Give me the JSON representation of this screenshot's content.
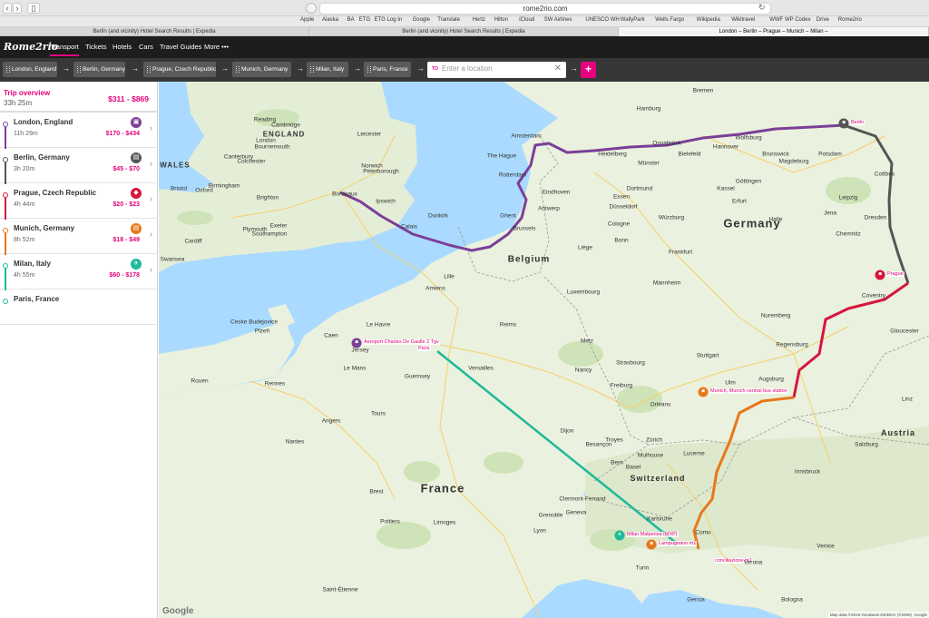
{
  "browser": {
    "url": "rome2rio.com",
    "back_icon": "chevron-left-icon",
    "forward_icon": "chevron-right-icon",
    "sidebar_icon": "sidebar-icon",
    "bookmarks": [
      "Apple",
      "Alaska",
      "BA",
      "ETG",
      "ETG Log In",
      "Google",
      "Translate",
      "Hertz",
      "Hilton",
      "iCloud",
      "SW Airlines",
      "UNESCO WH",
      "WallyPark",
      "Wells Fargo",
      "Wikipedia",
      "Wikitravel",
      "WWF",
      "WP Codex",
      "Drive",
      "Rome2rio"
    ],
    "tabs": [
      {
        "label": "Berlin (and vicinity) Hotel Search Results | Expedia",
        "active": false
      },
      {
        "label": "Berlin (and vicinity) Hotel Search Results | Expedia",
        "active": false
      },
      {
        "label": "London – Berlin – Prague – Munich – Milan –",
        "active": true
      }
    ]
  },
  "nav": {
    "logo": "Rome2rio",
    "items": [
      "Transport",
      "Tickets",
      "Hotels",
      "Cars",
      "Travel Guides",
      "More •••"
    ],
    "active": "Transport"
  },
  "route": {
    "stops": [
      "London, England",
      "Berlin, Germany",
      "Prague, Czech Republic",
      "Munich, Germany",
      "Milan, Italy",
      "Paris, France"
    ],
    "to_label": "TO",
    "to_placeholder": "Enter a location",
    "add_label": "+"
  },
  "trip": {
    "title": "Trip overview",
    "duration": "33h 25m",
    "price": "$311 - $869"
  },
  "legs": [
    {
      "city": "London, England",
      "duration": "11h 29m",
      "price": "$170 - $434",
      "mode": "train-icon",
      "color": "#7b3f98"
    },
    {
      "city": "Berlin, Germany",
      "duration": "3h 20m",
      "price": "$45 - $70",
      "mode": "bus-icon",
      "color": "#555555"
    },
    {
      "city": "Prague, Czech Republic",
      "duration": "4h 44m",
      "price": "$20 - $23",
      "mode": "car-icon",
      "color": "#d6163c"
    },
    {
      "city": "Munich, Germany",
      "duration": "8h 52m",
      "price": "$18 - $49",
      "mode": "bus-icon",
      "color": "#e8771a"
    },
    {
      "city": "Milan, Italy",
      "duration": "4h 55m",
      "price": "$60 - $178",
      "mode": "plane-icon",
      "color": "#1cb99a"
    },
    {
      "city": "Paris, France",
      "duration": "",
      "price": "",
      "mode": "",
      "color": ""
    }
  ],
  "colors": {
    "accent": "#e6007e",
    "train": "#7b3f98",
    "bus_berlin": "#555555",
    "car": "#d6163c",
    "bus_munich": "#e8771a",
    "plane": "#1cb99a",
    "water": "#aadaff",
    "land": "#eaf1de"
  },
  "map": {
    "countries": [
      "ENGLAND",
      "WALES",
      "Germany",
      "Belgium",
      "France",
      "Switzerland",
      "Austria"
    ],
    "stop_labels": [
      "Berlin",
      "Prague",
      "Munich, Munich central bus station",
      "Aeroport Charles De Gaulle 2 Tgv",
      "Paris",
      "Milan Malpensa (MXP)",
      "Lampugnano m1",
      "conciliazione m1"
    ],
    "cities": [
      "Hamburg",
      "Bremen",
      "Hannover",
      "Osnabrück",
      "Bielefeld",
      "Münster",
      "Brunswick",
      "Wolfsburg",
      "Magdeburg",
      "Potsdam",
      "Leipzig",
      "Dresden",
      "Chemnitz",
      "Cottbus",
      "Göttingen",
      "Kassel",
      "Dortmund",
      "Essen",
      "Düsseldorf",
      "Cologne",
      "Bonn",
      "Frankfurt",
      "Mannheim",
      "Nuremberg",
      "Regensburg",
      "Stuttgart",
      "Augsburg",
      "Ulm",
      "Freiburg",
      "Zürich",
      "Lucerne",
      "Bern",
      "Geneva",
      "Lyon",
      "Turin",
      "Genoa",
      "Bologna",
      "Verona",
      "Venice",
      "Como",
      "Innsbruck",
      "Salzburg",
      "Linz",
      "Amsterdam",
      "The Hague",
      "Rotterdam",
      "Eindhoven",
      "Antwerp",
      "Ghent",
      "Brussels",
      "Liège",
      "Luxembourg",
      "Lille",
      "Calais",
      "Dunkirk",
      "Amiens",
      "Reims",
      "Metz",
      "Strasbourg",
      "Nancy",
      "Dijon",
      "Besançon",
      "Rennes",
      "Nantes",
      "Angers",
      "Tours",
      "Le Mans",
      "Caen",
      "Le Havre",
      "Rouen",
      "Brest",
      "Poitiers",
      "Limoges",
      "Clermont-Ferrand",
      "Grenoble",
      "Saint-Étienne",
      "Bordeaux",
      "London",
      "Birmingham",
      "Oxford",
      "Bristol",
      "Cardiff",
      "Swansea",
      "Exeter",
      "Plymouth",
      "Southampton",
      "Brighton",
      "Bournemouth",
      "Reading",
      "Cambridge",
      "Leicester",
      "Peterborough",
      "Norwich",
      "Ipswich",
      "Colchester",
      "Canterbury",
      "Coventry",
      "Gloucester",
      "Plzeň",
      "Ceske Budejovice",
      "Jersey",
      "Guernsey",
      "Versailles",
      "Orléans",
      "Troyes",
      "Mulhouse",
      "Basel",
      "Karlsruhe",
      "Heidelberg",
      "Würzburg",
      "Erfurt",
      "Jena",
      "Halle"
    ],
    "attribution": "Map data ©2019 GeoBasis-DE/BKG (©2009), Google",
    "google": "Google"
  }
}
